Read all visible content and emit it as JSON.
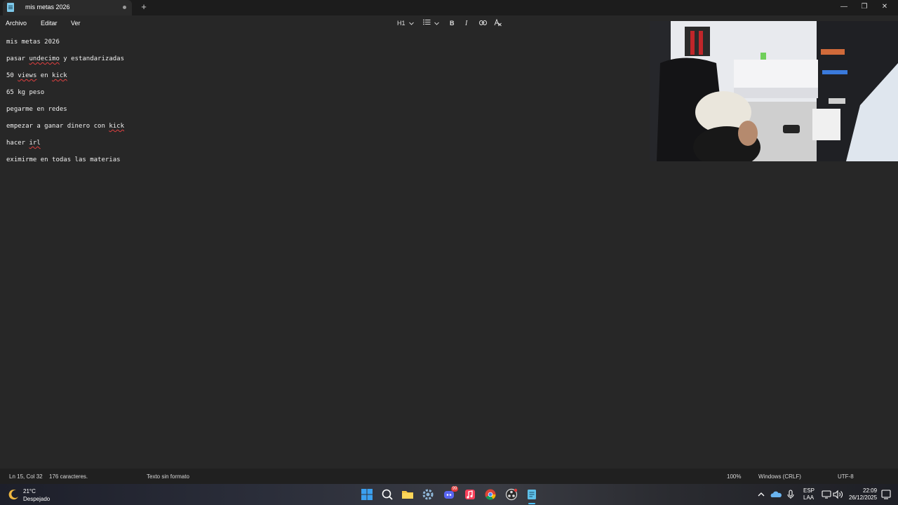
{
  "window": {
    "tab_title": "mis metas 2026",
    "new_tab_label": "+",
    "minimize_label": "—",
    "maximize_label": "❐",
    "close_label": "✕"
  },
  "menu": {
    "file": "Archivo",
    "edit": "Editar",
    "view": "Ver"
  },
  "format_toolbar": {
    "heading_label": "H1",
    "heading_icon": "chevron-down-icon",
    "list_icon": "bulleted-list-icon",
    "bold_label": "B",
    "italic_label": "I",
    "link_icon": "link-icon",
    "clear_format_icon": "clear-formatting-icon"
  },
  "document": {
    "lines": [
      {
        "parts": [
          {
            "t": "mis metas 2026",
            "sq": false
          }
        ]
      },
      {
        "parts": [
          {
            "t": "pasar ",
            "sq": false
          },
          {
            "t": "undecimo",
            "sq": true
          },
          {
            "t": " y estandarizadas",
            "sq": false
          }
        ]
      },
      {
        "parts": [
          {
            "t": "50 ",
            "sq": false
          },
          {
            "t": "views",
            "sq": true
          },
          {
            "t": " en ",
            "sq": false
          },
          {
            "t": "kick",
            "sq": true
          }
        ]
      },
      {
        "parts": [
          {
            "t": "65 kg peso",
            "sq": false
          }
        ]
      },
      {
        "parts": [
          {
            "t": "pegarme en redes",
            "sq": false
          }
        ]
      },
      {
        "parts": [
          {
            "t": "empezar a ganar dinero con ",
            "sq": false
          },
          {
            "t": "kick",
            "sq": true
          }
        ]
      },
      {
        "parts": [
          {
            "t": "hacer ",
            "sq": false
          },
          {
            "t": "irl",
            "sq": true
          }
        ]
      },
      {
        "parts": [
          {
            "t": "eximirme en todas las materias",
            "sq": false
          }
        ]
      }
    ]
  },
  "status": {
    "position": "Ln 15, Col 32",
    "characters": "176 caracteres.",
    "format": "Texto sin formato",
    "zoom": "100%",
    "line_endings": "Windows (CRLF)",
    "encoding": "UTF-8"
  },
  "taskbar": {
    "temperature": "21°C",
    "weather": "Despejado",
    "weather_icon": "moon-icon",
    "discord_badge": "99",
    "language_line1": "ESP",
    "language_line2": "LAA",
    "time": "22:09",
    "date": "26/12/2025",
    "apps": [
      "windows-start-icon",
      "search-icon",
      "file-explorer-icon",
      "settings-icon",
      "discord-icon",
      "apple-music-icon",
      "chrome-icon",
      "obs-icon",
      "notepad-icon"
    ]
  },
  "colors": {
    "editor_bg": "#272727",
    "titlebar_bg": "#1c1c1c",
    "spellcheck": "#e04040",
    "accent": "#4cc2ff"
  }
}
